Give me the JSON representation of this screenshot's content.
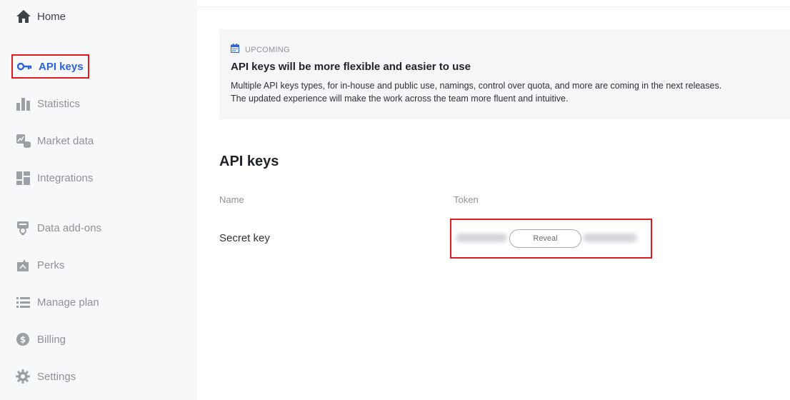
{
  "sidebar": {
    "items": [
      {
        "label": "Home",
        "icon": "home-icon"
      },
      {
        "label": "API keys",
        "icon": "key-icon",
        "active": true
      },
      {
        "label": "Statistics",
        "icon": "bar-chart-icon"
      },
      {
        "label": "Market data",
        "icon": "market-data-icon"
      },
      {
        "label": "Integrations",
        "icon": "integrations-grid-icon"
      },
      {
        "label": "Data add-ons",
        "icon": "data-addons-icon"
      },
      {
        "label": "Perks",
        "icon": "perks-icon"
      },
      {
        "label": "Manage plan",
        "icon": "list-icon"
      },
      {
        "label": "Billing",
        "icon": "dollar-icon"
      },
      {
        "label": "Settings",
        "icon": "gear-icon"
      }
    ]
  },
  "banner": {
    "tag": "UPCOMING",
    "title": "API keys will be more flexible and easier to use",
    "body_line1": "Multiple API keys types, for in-house and public use, namings, control over quota, and more are coming in the next releases.",
    "body_line2": "The updated experience will make the work across the team more fluent and intuitive."
  },
  "api_keys": {
    "title": "API keys",
    "columns": [
      "Name",
      "Token"
    ],
    "rows": [
      {
        "name": "Secret key",
        "reveal_label": "Reveal"
      }
    ]
  },
  "colors": {
    "accent": "#2b63d9",
    "highlight_border": "#e0191e",
    "sidebar_bg": "#f7f8fa"
  }
}
